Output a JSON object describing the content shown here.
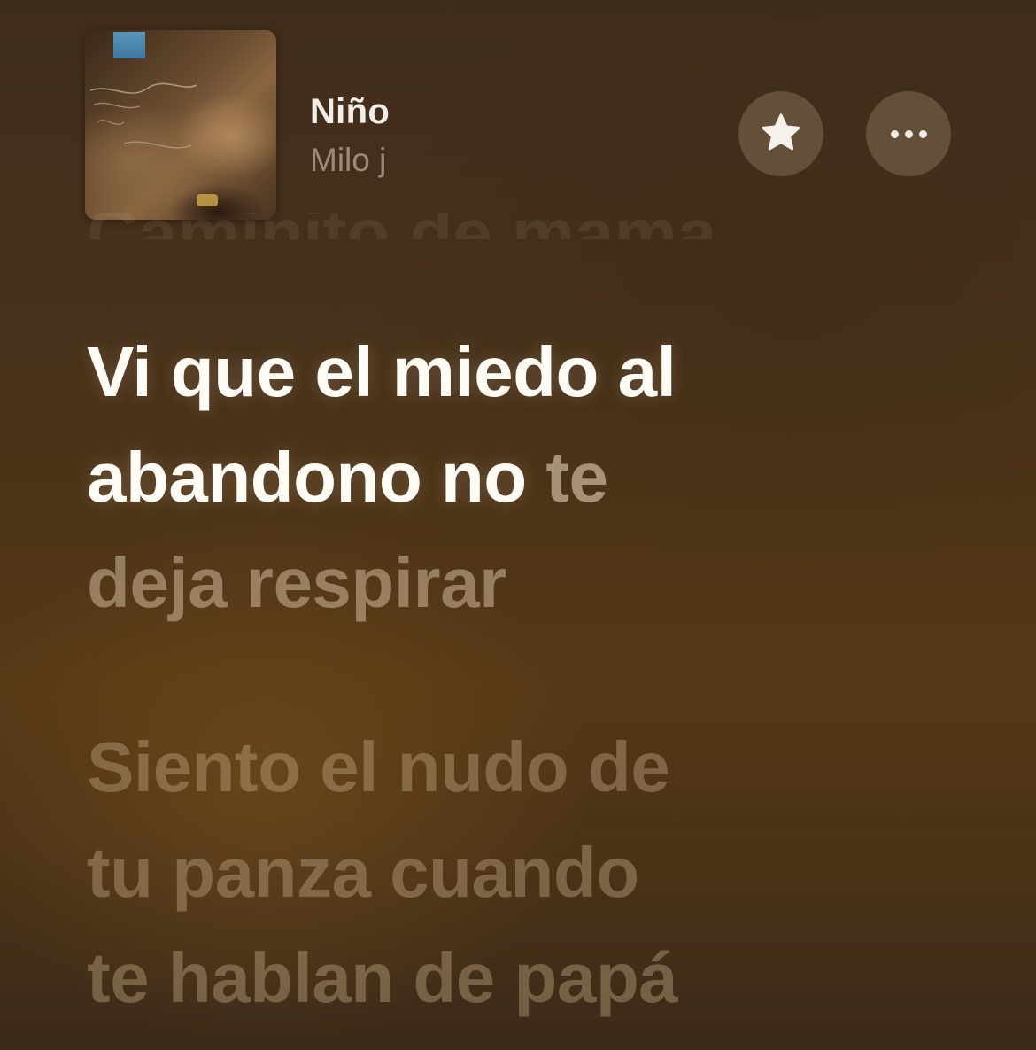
{
  "now_playing": {
    "title": "Niño",
    "artist": "Milo j",
    "artwork_icon": "album-artwork-icon",
    "favorite_icon": "star-icon",
    "more_icon": "ellipsis-icon"
  },
  "lyrics": {
    "previous_line": "Caminito de mama",
    "active": {
      "line1": "Vi que el miedo al",
      "line2_sung": "abandono no",
      "line2_partial": "te",
      "line3": "deja respirar"
    },
    "next": {
      "line1": "Siento el nudo de",
      "line2": "tu panza cuando",
      "line3": "te hablan de papá"
    }
  },
  "colors": {
    "background": "#4a3219",
    "sung_text": "#fffcf6",
    "unsung_text": "#c8b08c",
    "button_fill": "#967e64"
  }
}
